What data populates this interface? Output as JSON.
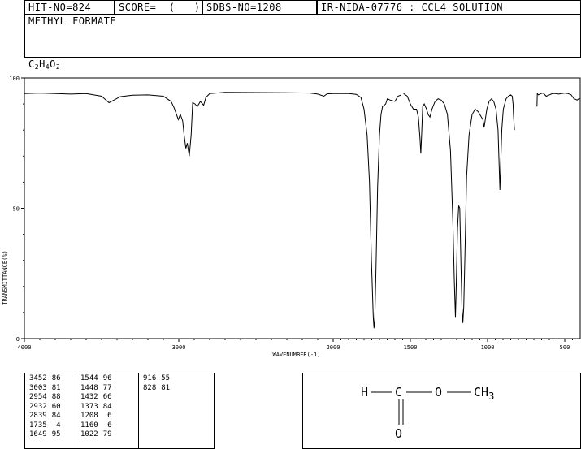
{
  "header": {
    "hit_no": "HIT-NO=824",
    "score": "SCORE=  (   )",
    "sdbs_no": "SDBS-NO=1208",
    "ir_code": "IR-NIDA-07776 : CCL4 SOLUTION"
  },
  "compound": {
    "name": "METHYL FORMATE",
    "formula_parts": [
      "C",
      "2",
      "H",
      "4",
      "O",
      "2"
    ]
  },
  "chart_data": {
    "type": "line",
    "title": "",
    "xlabel": "WAVENUMBER(-1)",
    "ylabel": "TRANSMITTANCE(%)",
    "xlim": [
      4000,
      400
    ],
    "ylim": [
      0,
      100
    ],
    "x_ticks": [
      4000,
      3000,
      2000,
      1500,
      1000,
      500
    ],
    "y_ticks": [
      0,
      50,
      100
    ],
    "grid": false,
    "segments": [
      [
        [
          4000,
          94
        ],
        [
          3900,
          94.2
        ],
        [
          3800,
          94
        ],
        [
          3700,
          93.8
        ],
        [
          3600,
          94
        ],
        [
          3550,
          93.5
        ],
        [
          3500,
          93
        ],
        [
          3452,
          90.5
        ],
        [
          3420,
          91.5
        ],
        [
          3380,
          92.8
        ],
        [
          3300,
          93.4
        ],
        [
          3200,
          93.5
        ],
        [
          3100,
          93
        ],
        [
          3050,
          91
        ],
        [
          3030,
          88.5
        ],
        [
          3015,
          86
        ],
        [
          3003,
          84
        ],
        [
          2990,
          86
        ],
        [
          2975,
          83.5
        ],
        [
          2965,
          78
        ],
        [
          2954,
          73
        ],
        [
          2945,
          75
        ],
        [
          2932,
          70
        ],
        [
          2920,
          78
        ],
        [
          2910,
          90.5
        ],
        [
          2895,
          90
        ],
        [
          2880,
          89
        ],
        [
          2860,
          91
        ],
        [
          2839,
          89.5
        ],
        [
          2825,
          92.5
        ],
        [
          2800,
          94
        ],
        [
          2700,
          94.5
        ],
        [
          2500,
          94.4
        ],
        [
          2300,
          94.3
        ],
        [
          2150,
          94.2
        ],
        [
          2100,
          93.8
        ],
        [
          2060,
          93
        ],
        [
          2040,
          93.9
        ],
        [
          2000,
          94
        ],
        [
          1950,
          94
        ],
        [
          1900,
          94
        ],
        [
          1850,
          93.7
        ],
        [
          1820,
          92.5
        ],
        [
          1800,
          88
        ],
        [
          1780,
          78
        ],
        [
          1765,
          60
        ],
        [
          1752,
          30
        ],
        [
          1740,
          8
        ],
        [
          1735,
          4
        ],
        [
          1730,
          8
        ],
        [
          1722,
          28
        ],
        [
          1712,
          58
        ],
        [
          1700,
          78
        ],
        [
          1690,
          86
        ],
        [
          1680,
          89
        ],
        [
          1670,
          89.5
        ],
        [
          1660,
          90
        ],
        [
          1649,
          92
        ],
        [
          1630,
          91.5
        ],
        [
          1600,
          91
        ],
        [
          1580,
          93
        ],
        [
          1560,
          93.5
        ]
      ],
      [
        [
          1544,
          94
        ],
        [
          1520,
          93
        ],
        [
          1500,
          90
        ],
        [
          1480,
          88
        ],
        [
          1460,
          88
        ],
        [
          1448,
          85
        ],
        [
          1438,
          77
        ],
        [
          1432,
          71
        ],
        [
          1426,
          80
        ],
        [
          1420,
          89
        ],
        [
          1410,
          90
        ],
        [
          1395,
          88
        ],
        [
          1385,
          86
        ],
        [
          1373,
          85
        ],
        [
          1360,
          88
        ],
        [
          1340,
          91
        ],
        [
          1320,
          92
        ],
        [
          1300,
          91.5
        ],
        [
          1280,
          90
        ],
        [
          1260,
          86
        ],
        [
          1240,
          72
        ],
        [
          1225,
          45
        ],
        [
          1215,
          22
        ],
        [
          1208,
          8
        ],
        [
          1202,
          22
        ],
        [
          1195,
          42
        ],
        [
          1187,
          51
        ],
        [
          1180,
          50
        ],
        [
          1172,
          28
        ],
        [
          1166,
          12
        ],
        [
          1160,
          6
        ],
        [
          1154,
          12
        ],
        [
          1146,
          34
        ],
        [
          1136,
          62
        ],
        [
          1120,
          78
        ],
        [
          1100,
          86
        ],
        [
          1080,
          88
        ],
        [
          1060,
          87
        ],
        [
          1040,
          85
        ],
        [
          1030,
          84
        ],
        [
          1022,
          81
        ],
        [
          1015,
          84
        ],
        [
          1005,
          88
        ],
        [
          990,
          91
        ],
        [
          975,
          92
        ],
        [
          960,
          91
        ],
        [
          945,
          88
        ],
        [
          932,
          80
        ],
        [
          924,
          65
        ],
        [
          920,
          57
        ],
        [
          915,
          66
        ],
        [
          908,
          80
        ],
        [
          898,
          88
        ],
        [
          880,
          92
        ],
        [
          865,
          93
        ],
        [
          850,
          93.5
        ],
        [
          840,
          93
        ],
        [
          835,
          90
        ],
        [
          832,
          86
        ],
        [
          828,
          82
        ],
        [
          826,
          80
        ]
      ],
      [
        [
          680,
          89
        ],
        [
          678,
          94
        ],
        [
          670,
          93.5
        ],
        [
          655,
          94
        ],
        [
          640,
          94.2
        ],
        [
          620,
          93
        ],
        [
          600,
          93.5
        ],
        [
          580,
          94
        ],
        [
          560,
          94
        ],
        [
          540,
          93.8
        ],
        [
          520,
          94
        ],
        [
          500,
          94.2
        ],
        [
          480,
          94
        ],
        [
          460,
          93.6
        ],
        [
          440,
          92
        ],
        [
          430,
          91.8
        ],
        [
          420,
          91.5
        ],
        [
          410,
          92
        ],
        [
          400,
          92
        ]
      ]
    ],
    "peak_table": {
      "columns": [
        "wavenumber",
        "transmittance"
      ],
      "groups": [
        [
          [
            3452,
            86
          ],
          [
            3003,
            81
          ],
          [
            2954,
            88
          ],
          [
            2932,
            60
          ],
          [
            2839,
            84
          ],
          [
            1735,
            4
          ],
          [
            1649,
            95
          ]
        ],
        [
          [
            1544,
            96
          ],
          [
            1448,
            77
          ],
          [
            1432,
            66
          ],
          [
            1373,
            84
          ],
          [
            1208,
            6
          ],
          [
            1160,
            6
          ],
          [
            1022,
            79
          ]
        ],
        [
          [
            916,
            55
          ],
          [
            828,
            81
          ]
        ]
      ]
    }
  },
  "structure": {
    "atoms": [
      "H",
      "C",
      "O",
      "CH",
      "3",
      "O"
    ]
  }
}
